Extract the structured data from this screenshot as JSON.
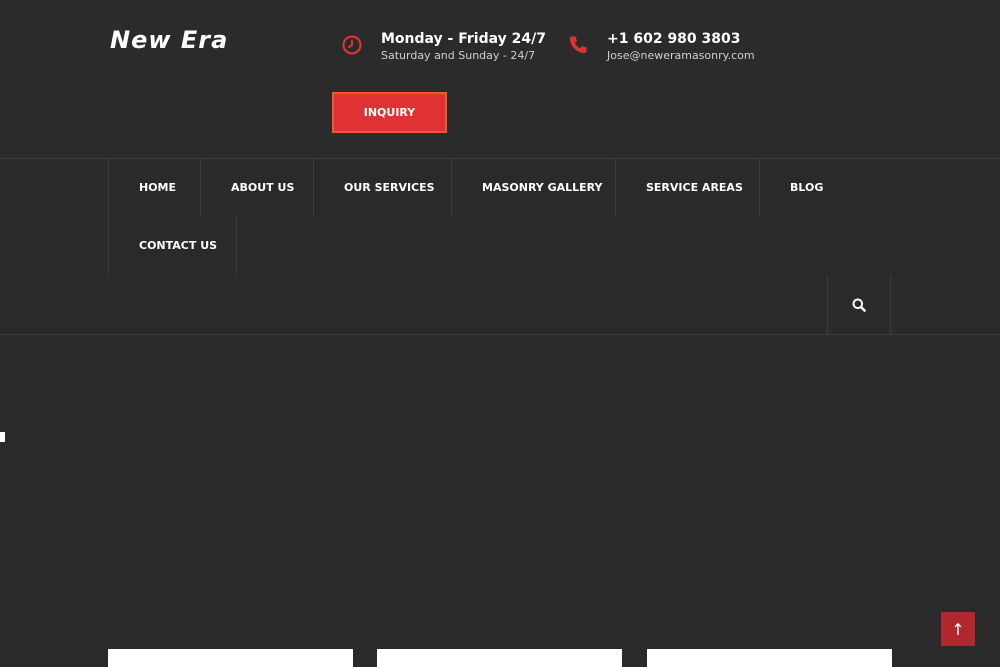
{
  "header": {
    "logo": "New Era",
    "hours": {
      "title": "Monday - Friday 24/7",
      "subtitle": "Saturday and Sunday - 24/7",
      "icon": "clock-icon"
    },
    "contact": {
      "phone": "+1 602 980 3803",
      "email": "Jose@neweramasonry.com",
      "icon": "phone-icon"
    },
    "inquiry_label": "INQUIRY"
  },
  "nav": {
    "items": [
      "HOME",
      "ABOUT US",
      "OUR SERVICES",
      "MASONRY GALLERY",
      "SERVICE AREAS",
      "BLOG",
      "CONTACT US"
    ],
    "search_icon": "search-icon"
  },
  "back_to_top": {
    "icon": "arrow-up-icon",
    "glyph": "↑"
  },
  "colors": {
    "background": "#2a2a2a",
    "accent": "#e03232",
    "accent_border": "#f2592a",
    "back_to_top": "#b0282d"
  }
}
